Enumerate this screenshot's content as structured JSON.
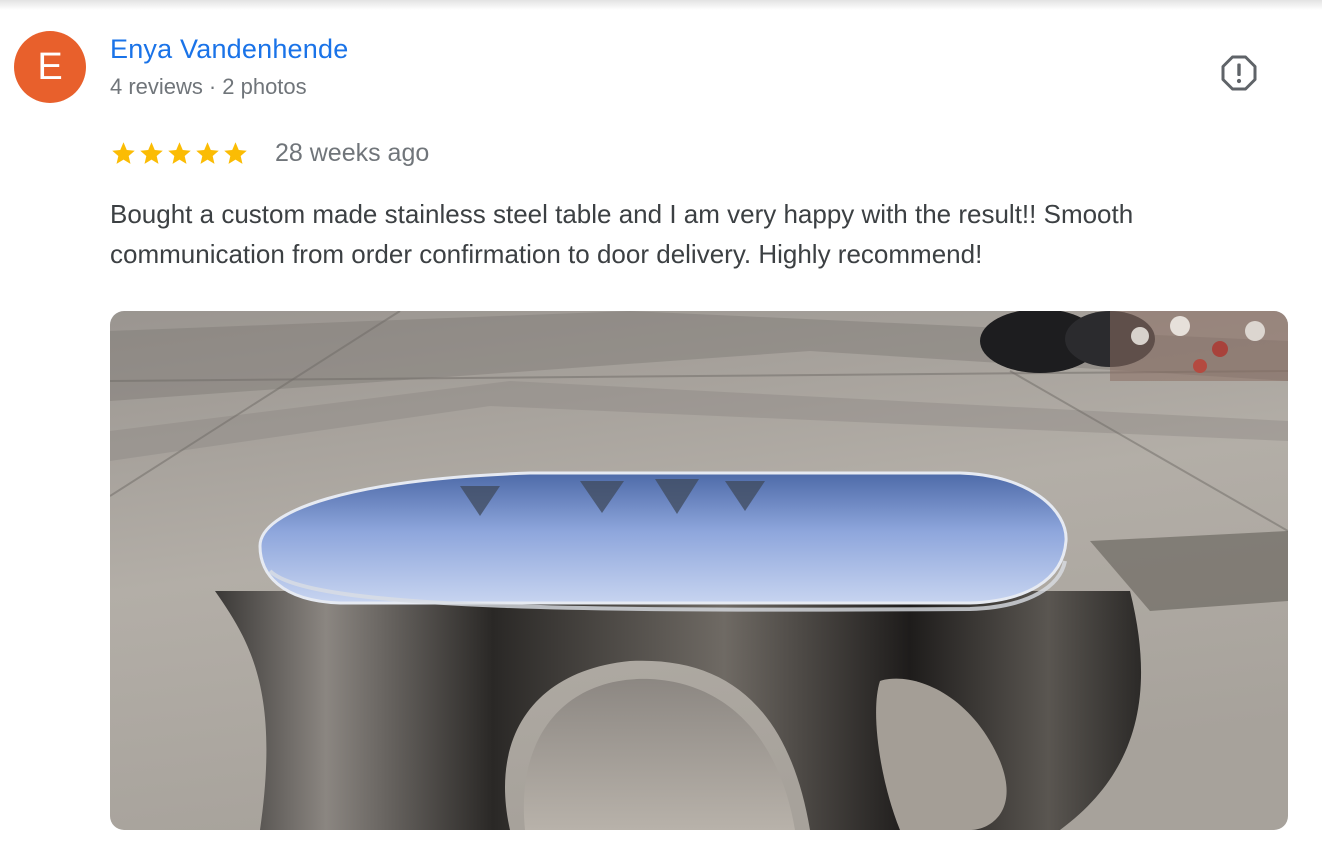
{
  "review": {
    "avatar_letter": "E",
    "avatar_color": "#e8602c",
    "name": "Enya Vandenhende",
    "reviews_count": "4 reviews",
    "separator": "·",
    "photos_count": "2 photos",
    "rating": 5,
    "rating_max": 5,
    "star_color": "#fbbc04",
    "date": "28 weeks ago",
    "text": "Bought a custom made stainless steel table and I am very happy with the result!! Smooth communication from order confirmation to door delivery. Highly recommend!",
    "report_icon": "report-flag-icon",
    "photo_icon": "review-photo"
  },
  "colors": {
    "link": "#1a73e8",
    "text": "#3c4043",
    "muted": "#70757a"
  }
}
